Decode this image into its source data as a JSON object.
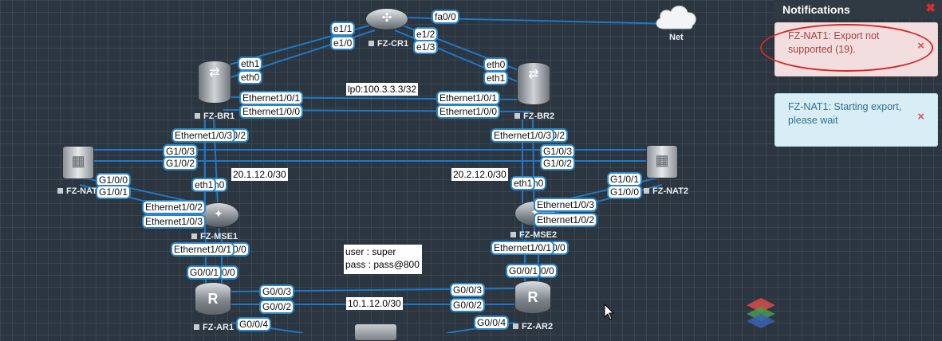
{
  "nodes": {
    "cr1": "FZ-CR1",
    "br1": "FZ-BR1",
    "br2": "FZ-BR2",
    "nat1": "FZ-NAT",
    "nat2": "FZ-NAT2",
    "mse1": "FZ-MSE1",
    "mse2": "FZ-MSE2",
    "ar1": "FZ-AR1",
    "ar2": "FZ-AR2",
    "net": "Net"
  },
  "ports": {
    "cr1_fa00": "fa0/0",
    "cr1_e11": "e1/1",
    "cr1_e10": "e1/0",
    "cr1_e12": "e1/2",
    "cr1_e13": "e1/3",
    "br1_eth1": "eth1",
    "br1_eth0": "eth0",
    "br2_eth0": "eth0",
    "br2_eth1": "eth1",
    "br1_e101": "Ethernet1/0/1",
    "br1_e100": "Ethernet1/0/0",
    "br2_e101": "Ethernet1/0/1",
    "br2_e100": "Ethernet1/0/0",
    "br1_e103": "Ethernet1/0/3",
    "br1_e102_tail": "/0/2",
    "br2_e103": "Ethernet1/0/3",
    "br2_e102_tail": "/0/2",
    "nat1_g103": "G1/0/3",
    "nat1_g102": "G1/0/2",
    "nat1_g100": "G1/0/0",
    "nat1_g101": "G1/0/1",
    "nat2_g103": "G1/0/3",
    "nat2_g102": "G1/0/2",
    "nat2_g101": "G1/0/1",
    "nat2_g100": "G1/0/0",
    "mse1_eth1": "eth1",
    "mse1_h0": "h0",
    "mse2_eth1": "eth1",
    "mse2_h0": "h0",
    "mse1_e102": "Ethernet1/0/2",
    "mse1_e103": "Ethernet1/0/3",
    "mse2_e103": "Ethernet1/0/3",
    "mse2_e102": "Ethernet1/0/2",
    "mse1_e101": "Ethernet1/0/1",
    "mse1_e100_tail": "0/0",
    "mse2_e101": "Ethernet1/0/1",
    "mse2_e100_tail": "0/0",
    "ar1_g001": "G0/0/1",
    "ar1_g000_tail": "0/0",
    "ar2_g001": "G0/0/1",
    "ar2_g000_tail": "0/0",
    "ar1_g003": "G0/0/3",
    "ar1_g002": "G0/0/2",
    "ar2_g003": "G0/0/3",
    "ar2_g002": "G0/0/2",
    "ar1_g004": "G0/0/4",
    "ar2_g004": "G0/0/4"
  },
  "notes": {
    "loopback": "lp0:100.3.3.3/32",
    "subnet_left": "20.1.12.0/30",
    "subnet_right": "20.2.12.0/30",
    "subnet_bottom": "10.1.12.0/30",
    "user": "user : super",
    "pass": "pass : pass@800"
  },
  "notifications": {
    "title": "Notifications",
    "close": "✖",
    "items": [
      {
        "type": "error",
        "text": "FZ-NAT1: Export not supported (19).",
        "dismiss": "×"
      },
      {
        "type": "info",
        "text": "FZ-NAT1: Starting export, please wait",
        "dismiss": "×"
      }
    ]
  },
  "colors": {
    "link": "#1e78c8",
    "label_border": "#2a86c6",
    "canvas": "#2b3640",
    "error_bg": "#f2dede",
    "info_bg": "#d9edf7",
    "highlight": "#d9262c"
  }
}
